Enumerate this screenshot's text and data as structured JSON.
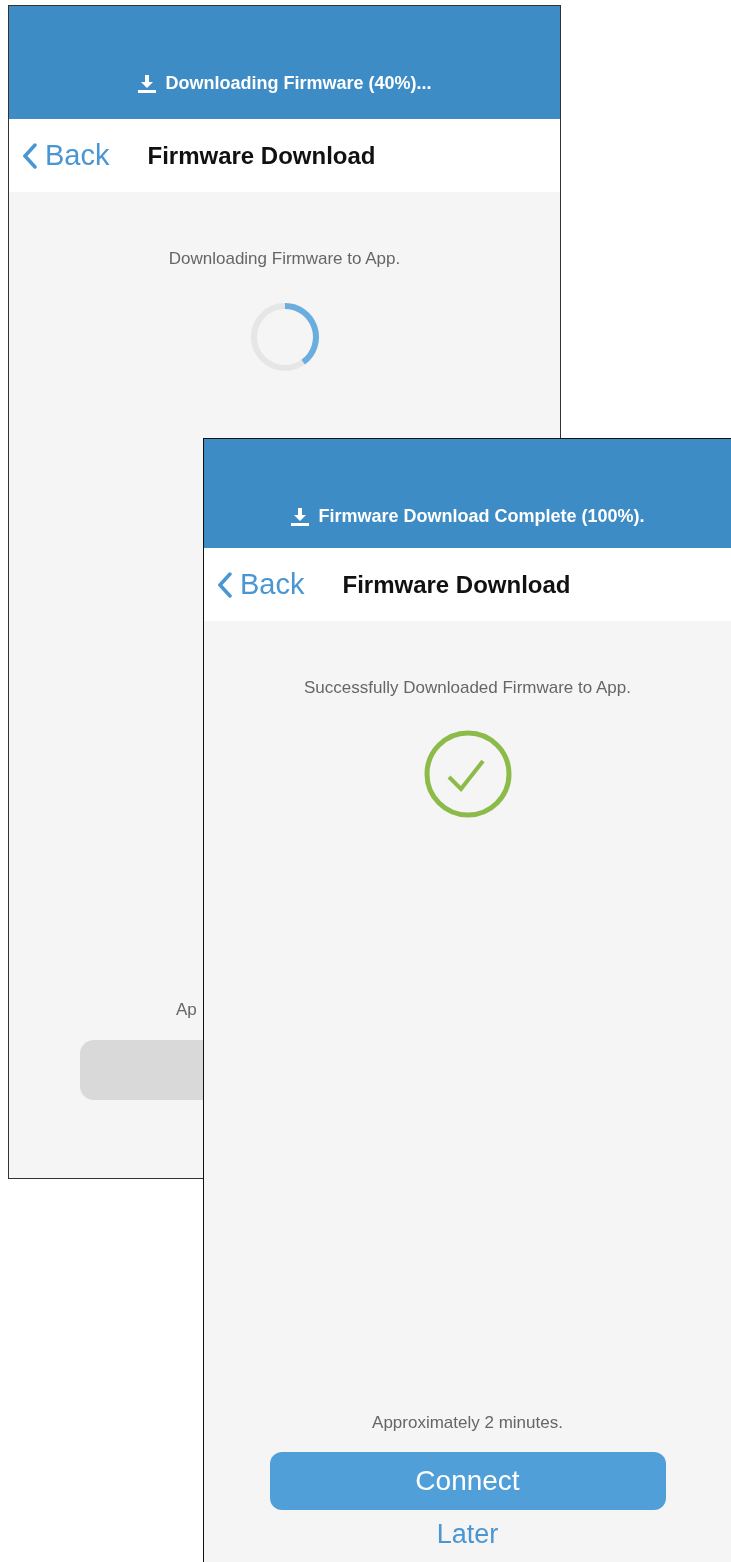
{
  "screens": [
    {
      "banner": "Downloading Firmware (40%)...",
      "back": "Back",
      "title": "Firmware Download",
      "message": "Downloading Firmware to App.",
      "status": {
        "kind": "spinner",
        "level": 0.4
      },
      "footnote": "Ap",
      "primary_button": {
        "disabled": true
      }
    },
    {
      "banner": "Firmware Download Complete (100%).",
      "back": "Back",
      "title": "Firmware Download",
      "message": "Successfully Downloaded Firmware to App.",
      "status": {
        "kind": "check"
      },
      "footnote": "Approximately 2 minutes.",
      "primary_button": {
        "label": "Connect",
        "disabled": false
      },
      "link": "Later"
    }
  ]
}
